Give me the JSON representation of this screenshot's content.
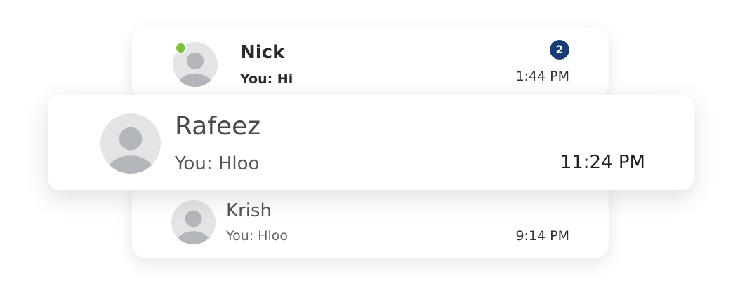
{
  "chats": [
    {
      "name": "Nick",
      "preview": "You: Hi",
      "time": "1:44 PM",
      "unread_count": "2",
      "online": true
    },
    {
      "name": "Rafeez",
      "preview": "You: Hloo",
      "time": "11:24 PM"
    },
    {
      "name": "Krish",
      "preview": "You: Hloo",
      "time": "9:14 PM"
    }
  ],
  "colors": {
    "online_dot": "#7cbf3f",
    "unread_badge": "#173e74",
    "avatar_bg": "#e3e4e6",
    "avatar_figure": "#b3b6ba"
  },
  "icons": {
    "avatar": "default-user-avatar-icon",
    "presence": "online-status-dot"
  }
}
